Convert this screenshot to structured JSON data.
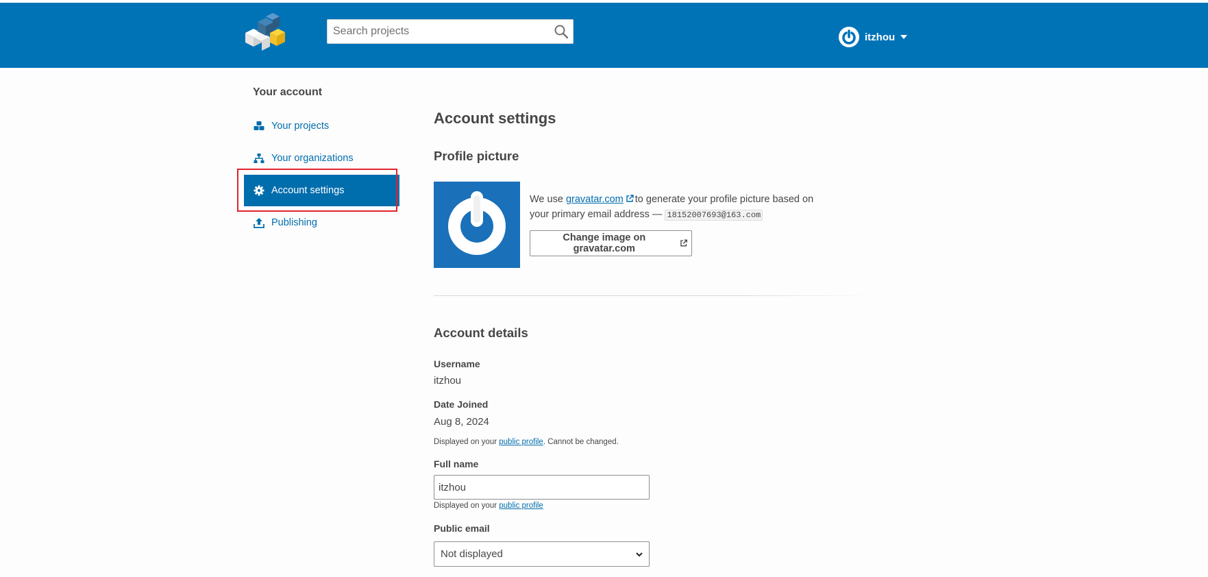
{
  "header": {
    "search_placeholder": "Search projects",
    "username": "itzhou",
    "logo_icon": "pypi-logo-icon",
    "search_icon": "search-icon",
    "avatar_icon": "gravatar-power-icon",
    "accent_color": "#0073b7"
  },
  "sidebar": {
    "title": "Your account",
    "items": [
      {
        "label": "Your projects",
        "icon": "cubes-icon",
        "active": false
      },
      {
        "label": "Your organizations",
        "icon": "sitemap-icon",
        "active": false
      },
      {
        "label": "Account settings",
        "icon": "gear-icon",
        "active": true
      },
      {
        "label": "Publishing",
        "icon": "upload-icon",
        "active": false
      }
    ]
  },
  "main": {
    "title": "Account settings",
    "profile_picture": {
      "heading": "Profile picture",
      "text_before": "We use",
      "link_text": "gravatar.com",
      "text_after": "to generate your profile picture based on your primary email address —",
      "email": "18152007693@163.com",
      "button_label": "Change image on gravatar.com"
    },
    "account_details": {
      "heading": "Account details",
      "username_label": "Username",
      "username_value": "itzhou",
      "date_joined_label": "Date Joined",
      "date_joined_value": "Aug 8, 2024",
      "date_help_before": "Displayed on your",
      "date_help_link": "public profile",
      "date_help_after": ". Cannot be changed.",
      "full_name_label": "Full name",
      "full_name_value": "itzhou",
      "full_name_help_before": "Displayed on your",
      "full_name_help_link": "public profile",
      "public_email_label": "Public email",
      "public_email_value": "Not displayed"
    }
  }
}
